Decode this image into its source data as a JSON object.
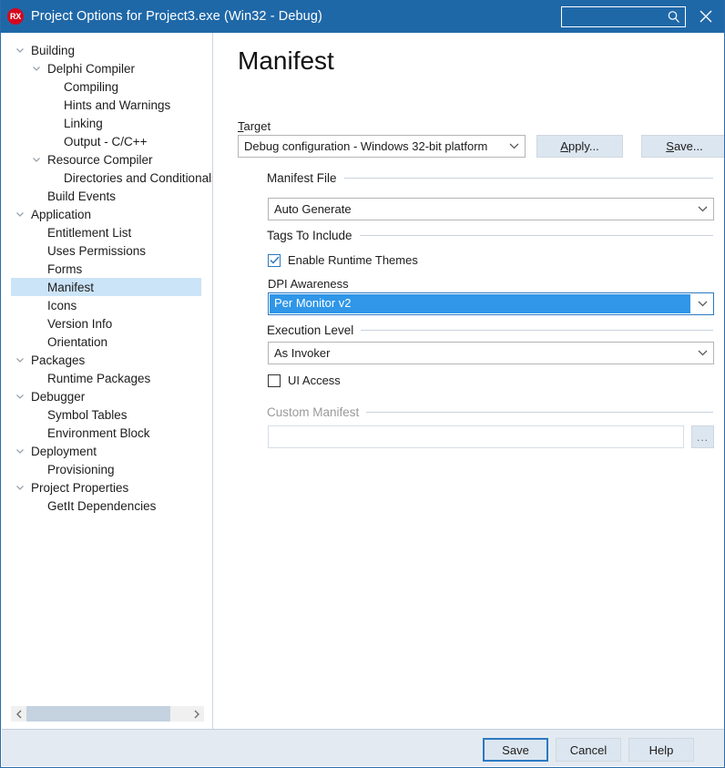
{
  "window": {
    "title": "Project Options for Project3.exe  (Win32 - Debug)",
    "icon": "rx-app-icon",
    "icon_text": "RX",
    "titlebar_color": "#1f68a8",
    "close_icon": "close-icon"
  },
  "search": {
    "value": "",
    "placeholder": "",
    "icon": "search-icon"
  },
  "sidebar": {
    "items": [
      {
        "label": "Building",
        "indent": 0,
        "expander": "chevron-down-icon",
        "selected": false
      },
      {
        "label": "Delphi Compiler",
        "indent": 1,
        "expander": "chevron-down-icon",
        "selected": false
      },
      {
        "label": "Compiling",
        "indent": 2,
        "expander": "",
        "selected": false
      },
      {
        "label": "Hints and Warnings",
        "indent": 2,
        "expander": "",
        "selected": false
      },
      {
        "label": "Linking",
        "indent": 2,
        "expander": "",
        "selected": false
      },
      {
        "label": "Output - C/C++",
        "indent": 2,
        "expander": "",
        "selected": false
      },
      {
        "label": "Resource Compiler",
        "indent": 1,
        "expander": "chevron-down-icon",
        "selected": false
      },
      {
        "label": "Directories and Conditionals",
        "indent": 2,
        "expander": "",
        "selected": false
      },
      {
        "label": "Build Events",
        "indent": 1,
        "expander": "",
        "selected": false
      },
      {
        "label": "Application",
        "indent": 0,
        "expander": "chevron-down-icon",
        "selected": false
      },
      {
        "label": "Entitlement List",
        "indent": 1,
        "expander": "",
        "selected": false
      },
      {
        "label": "Uses Permissions",
        "indent": 1,
        "expander": "",
        "selected": false
      },
      {
        "label": "Forms",
        "indent": 1,
        "expander": "",
        "selected": false
      },
      {
        "label": "Manifest",
        "indent": 1,
        "expander": "",
        "selected": true
      },
      {
        "label": "Icons",
        "indent": 1,
        "expander": "",
        "selected": false
      },
      {
        "label": "Version Info",
        "indent": 1,
        "expander": "",
        "selected": false
      },
      {
        "label": "Orientation",
        "indent": 1,
        "expander": "",
        "selected": false
      },
      {
        "label": "Packages",
        "indent": 0,
        "expander": "chevron-down-icon",
        "selected": false
      },
      {
        "label": "Runtime Packages",
        "indent": 1,
        "expander": "",
        "selected": false
      },
      {
        "label": "Debugger",
        "indent": 0,
        "expander": "chevron-down-icon",
        "selected": false
      },
      {
        "label": "Symbol Tables",
        "indent": 1,
        "expander": "",
        "selected": false
      },
      {
        "label": "Environment Block",
        "indent": 1,
        "expander": "",
        "selected": false
      },
      {
        "label": "Deployment",
        "indent": 0,
        "expander": "chevron-down-icon",
        "selected": false
      },
      {
        "label": "Provisioning",
        "indent": 1,
        "expander": "",
        "selected": false
      },
      {
        "label": "Project Properties",
        "indent": 0,
        "expander": "chevron-down-icon",
        "selected": false
      },
      {
        "label": "GetIt Dependencies",
        "indent": 1,
        "expander": "",
        "selected": false
      }
    ],
    "selection_color": "#cce4f7",
    "scrollbar": {
      "left_arrow_icon": "chevron-left-icon",
      "right_arrow_icon": "chevron-right-icon",
      "thumb_color": "#c4d2e0"
    }
  },
  "main": {
    "page_title": "Manifest",
    "target": {
      "label": "Target",
      "label_accel": "T",
      "value": "Debug configuration - Windows 32-bit platform",
      "arrow_icon": "chevron-down-icon"
    },
    "apply_button": {
      "label": "Apply...",
      "accel": "A"
    },
    "save_button_top": {
      "label": "Save...",
      "accel": "S"
    },
    "manifest_file": {
      "group_label": "Manifest File",
      "value": "Auto Generate",
      "arrow_icon": "chevron-down-icon"
    },
    "tags_to_include": {
      "group_label": "Tags To Include",
      "enable_runtime_themes": {
        "label": "Enable Runtime Themes",
        "checked": true,
        "icon": "checkmark-icon"
      }
    },
    "dpi_awareness": {
      "label": "DPI Awareness",
      "value": "Per Monitor v2",
      "focused": true,
      "highlight_color": "#2f96e8",
      "arrow_icon": "chevron-down-icon"
    },
    "execution_level": {
      "group_label": "Execution Level",
      "value": "As Invoker",
      "arrow_icon": "chevron-down-icon"
    },
    "ui_access": {
      "label": "UI Access",
      "checked": false
    },
    "custom_manifest": {
      "group_label": "Custom Manifest",
      "disabled": true,
      "value": "",
      "browse_button": "..."
    }
  },
  "footer": {
    "save": "Save",
    "cancel": "Cancel",
    "help": "Help"
  }
}
